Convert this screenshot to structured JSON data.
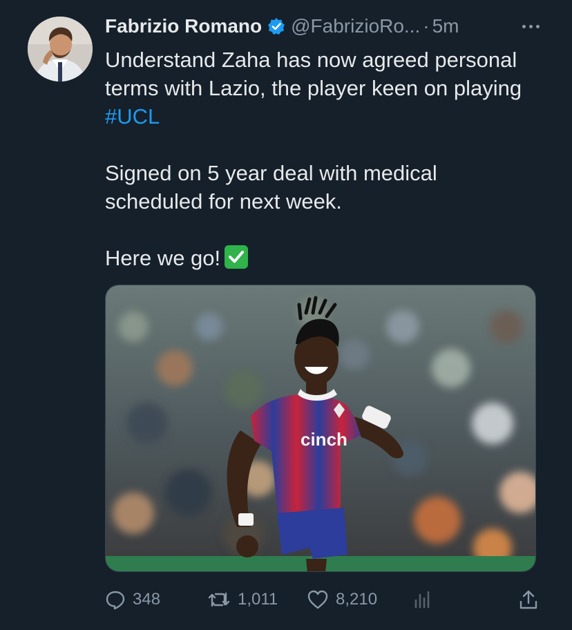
{
  "author": {
    "name": "Fabrizio Romano",
    "handle": "@FabrizioRo...",
    "separator": "·",
    "time": "5m",
    "verified_color": "#1d9bf0"
  },
  "tweet": {
    "line1": "Understand Zaha has now agreed personal terms with Lazio, the player keen on playing ",
    "hashtag": "#UCL",
    "line2": "Signed on 5 year deal with medical scheduled for next week.",
    "line3": "Here we go!",
    "emoji": "white-heavy-check-mark"
  },
  "media": {
    "kit_sponsor": "cinch"
  },
  "actions": {
    "replies": "348",
    "retweets": "1,011",
    "likes": "8,210"
  },
  "icons": [
    "verified-badge-icon",
    "more-icon",
    "reply-icon",
    "retweet-icon",
    "like-icon",
    "views-icon",
    "share-icon"
  ],
  "colors": {
    "background": "#15202b",
    "text": "#e7e9ea",
    "muted": "#8b98a5",
    "accent": "#1d9bf0"
  }
}
